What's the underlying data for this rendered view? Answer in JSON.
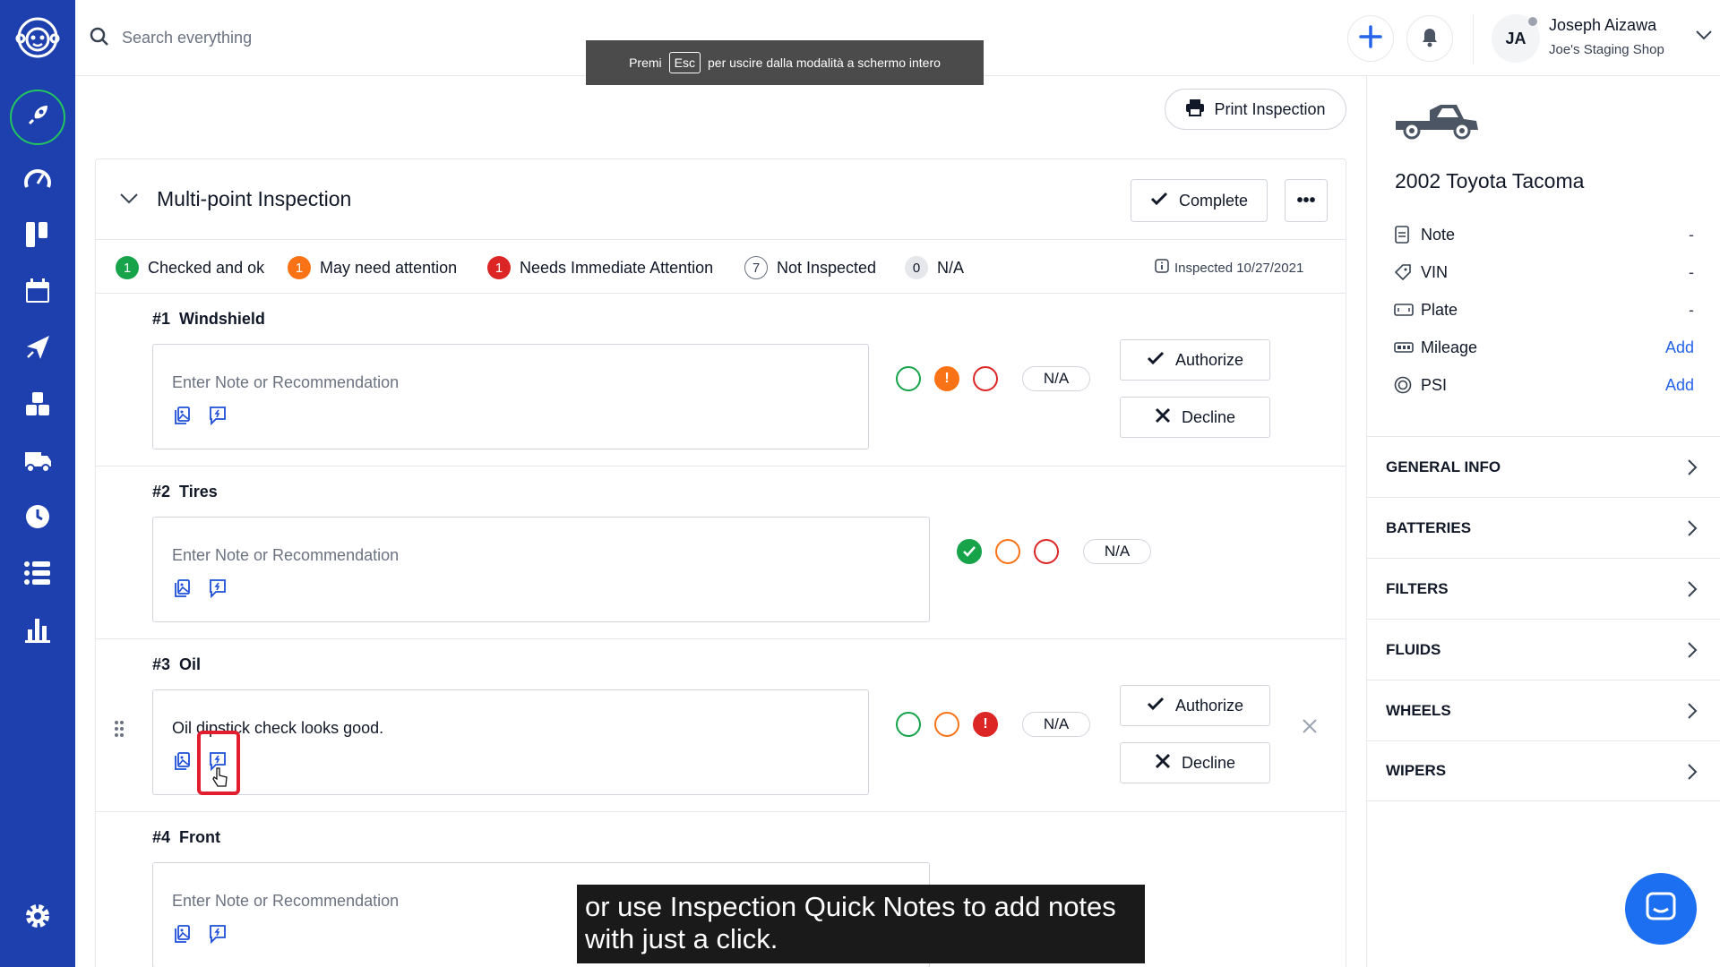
{
  "sidebar": {
    "items": [
      {
        "name": "logo-icon"
      },
      {
        "name": "rocket-icon",
        "active": true
      },
      {
        "name": "gauge-icon"
      },
      {
        "name": "board-icon"
      },
      {
        "name": "calendar-icon"
      },
      {
        "name": "send-icon"
      },
      {
        "name": "blocks-icon"
      },
      {
        "name": "truck-icon"
      },
      {
        "name": "clock-icon"
      },
      {
        "name": "list-icon"
      },
      {
        "name": "chart-icon"
      },
      {
        "name": "settings-icon"
      }
    ]
  },
  "header": {
    "search_placeholder": "Search everything",
    "user_initials": "JA",
    "user_name": "Joseph Aizawa",
    "user_shop": "Joe's Staging Shop"
  },
  "fullscreen_toast": {
    "prefix": "Premi",
    "key": "Esc",
    "suffix": "per uscire dalla modalità a schermo intero"
  },
  "print_label": "Print Inspection",
  "inspection": {
    "title": "Multi-point Inspection",
    "complete_label": "Complete",
    "more_label": "•••",
    "legend": [
      {
        "count": "1",
        "label": "Checked and ok",
        "color": "#16a34a"
      },
      {
        "count": "1",
        "label": "May need attention",
        "color": "#f97316"
      },
      {
        "count": "1",
        "label": "Needs Immediate Attention",
        "color": "#dc2626"
      },
      {
        "count": "7",
        "label": "Not Inspected",
        "color": "#9ca3af"
      },
      {
        "count": "0",
        "label": "N/A",
        "color": "#e5e7eb"
      }
    ],
    "inspected_date": "Inspected 10/27/2021",
    "items": [
      {
        "number": "#1",
        "name": "Windshield",
        "note": "",
        "placeholder": "Enter Note or Recommendation",
        "na": "N/A",
        "authorize": "Authorize",
        "decline": "Decline",
        "status": "attention"
      },
      {
        "number": "#2",
        "name": "Tires",
        "note": "",
        "placeholder": "Enter Note or Recommendation",
        "na": "N/A",
        "status": "ok"
      },
      {
        "number": "#3",
        "name": "Oil",
        "note": "Oil dipstick check looks good.",
        "placeholder": "Enter Note or Recommendation",
        "na": "N/A",
        "authorize": "Authorize",
        "decline": "Decline",
        "status": "immediate"
      },
      {
        "number": "#4",
        "name": "Front",
        "note": "",
        "placeholder": "Enter Note or Recommendation",
        "status": "none"
      }
    ]
  },
  "vehicle": {
    "name": "2002 Toyota Tacoma",
    "rows": [
      {
        "label": "Note",
        "value": "-"
      },
      {
        "label": "VIN",
        "value": "-"
      },
      {
        "label": "Plate",
        "value": "-"
      },
      {
        "label": "Mileage",
        "value": "Add"
      },
      {
        "label": "PSI",
        "value": "Add"
      }
    ],
    "sections": [
      "GENERAL INFO",
      "BATTERIES",
      "FILTERS",
      "FLUIDS",
      "WHEELS",
      "WIPERS"
    ]
  },
  "caption": {
    "line1": "or use Inspection Quick Notes to add notes",
    "line2": "with just a click."
  },
  "colors": {
    "sidebar": "#1e40af",
    "accent": "#2563eb",
    "ok": "#16a34a",
    "attention": "#f97316",
    "immediate": "#dc2626"
  }
}
